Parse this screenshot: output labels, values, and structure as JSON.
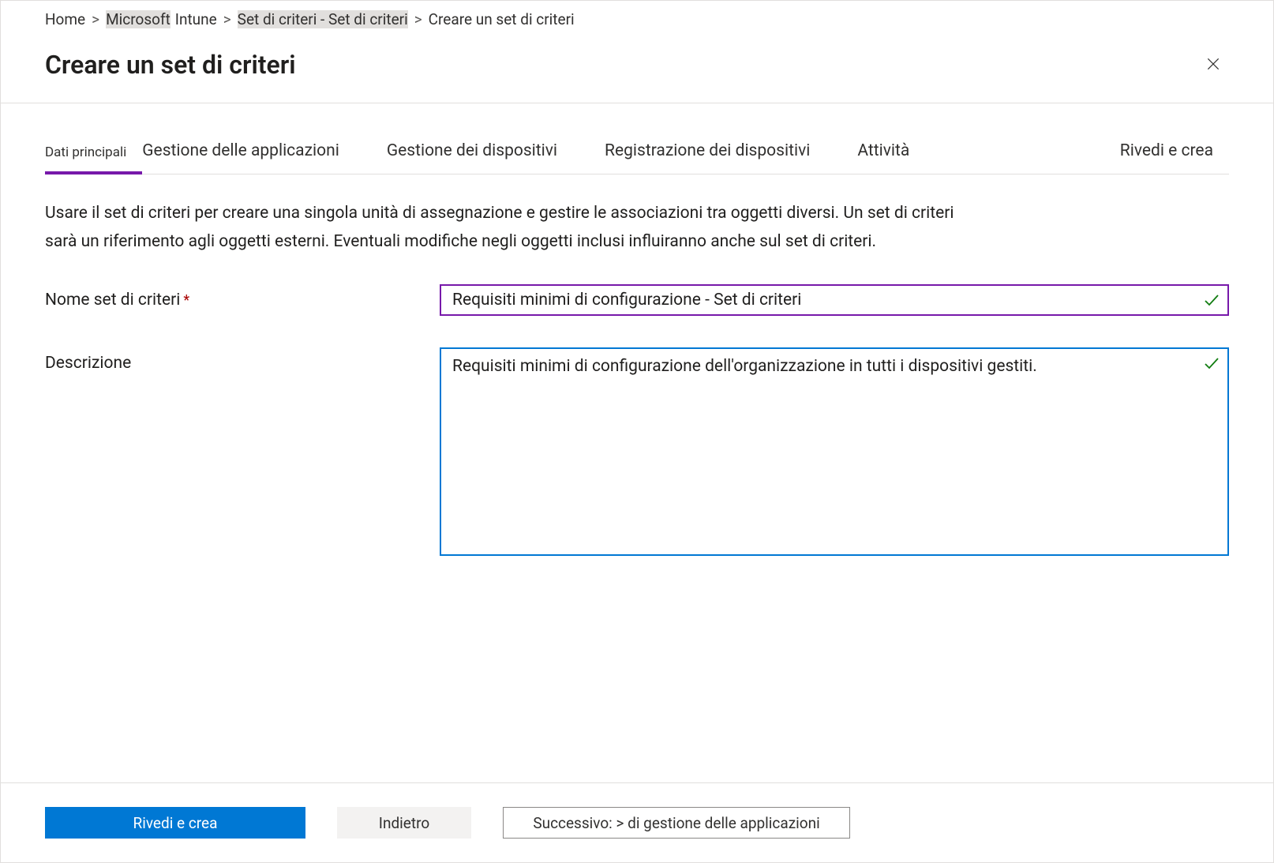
{
  "breadcrumb": {
    "items": [
      {
        "label": "Home",
        "sep": ">"
      },
      {
        "label": "Microsoft",
        "sep": ""
      },
      {
        "label": "Intune",
        "sep": ">"
      },
      {
        "label": "Set di criteri - Set di criteri",
        "sep": ">"
      }
    ],
    "current": "Creare un set di criteri"
  },
  "page": {
    "title": "Creare un set di criteri"
  },
  "tabs": [
    {
      "label": "Dati principali",
      "active": true
    },
    {
      "label": "Gestione delle applicazioni",
      "active": false
    },
    {
      "label": "Gestione dei dispositivi",
      "active": false
    },
    {
      "label": "Registrazione dei dispositivi",
      "active": false
    },
    {
      "label": "Attività",
      "active": false
    },
    {
      "label": "Rivedi e crea",
      "active": false
    }
  ],
  "descText": "Usare il set di criteri per creare una singola unità di assegnazione e gestire le associazioni tra oggetti diversi. Un set di criteri sarà un riferimento agli oggetti esterni. Eventuali modifiche negli oggetti inclusi influiranno anche sul set di criteri.",
  "form": {
    "name": {
      "label": "Nome set di criteri",
      "required": "*",
      "value": "Requisiti minimi di configurazione - Set di criteri",
      "valid": true
    },
    "description": {
      "label": "Descrizione",
      "value": "Requisiti minimi di configurazione dell'organizzazione in tutti i dispositivi gestiti.",
      "valid": true
    }
  },
  "footer": {
    "review": "Rivedi e crea",
    "back": "Indietro",
    "next": "Successivo: > di gestione delle applicazioni"
  },
  "icons": {
    "close": "close-icon",
    "check": "checkmark-icon"
  }
}
